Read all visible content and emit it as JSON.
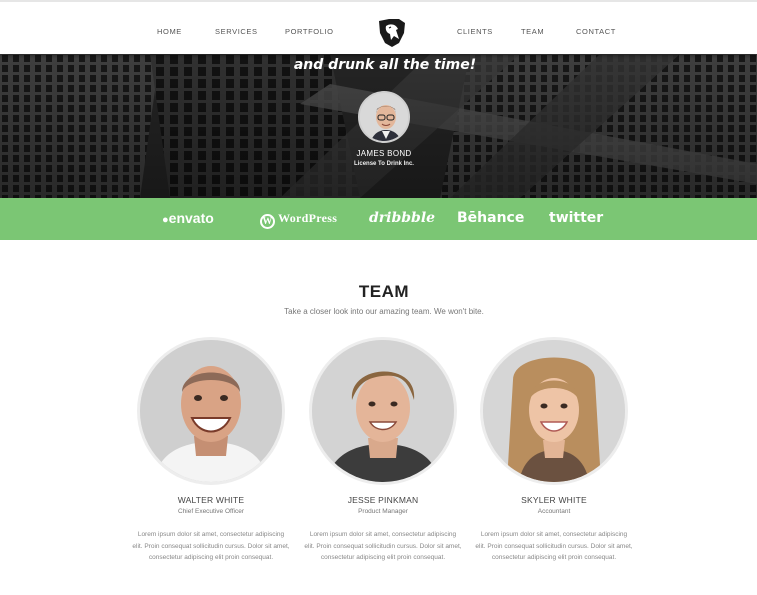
{
  "nav": {
    "items": [
      {
        "label": "HOME"
      },
      {
        "label": "SERVICES"
      },
      {
        "label": "PORTFOLIO"
      },
      {
        "label": "CLIENTS"
      },
      {
        "label": "TEAM"
      },
      {
        "label": "CONTACT"
      }
    ],
    "logo_icon": "horse-head-icon"
  },
  "testimonial": {
    "quote": "and drunk all the time!",
    "name": "JAMES BOND",
    "role": "License To Drink Inc."
  },
  "clients": {
    "bg_color": "#7bc674",
    "logos": [
      {
        "label": "envato",
        "icon": "leaf-icon"
      },
      {
        "label": "WordPress",
        "icon": "wordpress-icon"
      },
      {
        "label": "dribbble"
      },
      {
        "label": "Bēhance"
      },
      {
        "label": "twitter"
      }
    ]
  },
  "team": {
    "title": "TEAM",
    "subtitle": "Take a closer look into our amazing team. We won't bite.",
    "members": [
      {
        "name": "WALTER WHITE",
        "role": "Chief Executive Officer",
        "bio": "Lorem ipsum dolor sit amet, consectetur adipiscing elit. Proin consequat sollicitudin cursus. Dolor sit amet, consectetur adipiscing elit proin consequat."
      },
      {
        "name": "JESSE PINKMAN",
        "role": "Product Manager",
        "bio": "Lorem ipsum dolor sit amet, consectetur adipiscing elit. Proin consequat sollicitudin cursus. Dolor sit amet, consectetur adipiscing elit proin consequat."
      },
      {
        "name": "SKYLER WHITE",
        "role": "Accountant",
        "bio": "Lorem ipsum dolor sit amet, consectetur adipiscing elit. Proin consequat sollicitudin cursus. Dolor sit amet, consectetur adipiscing elit proin consequat."
      }
    ]
  }
}
